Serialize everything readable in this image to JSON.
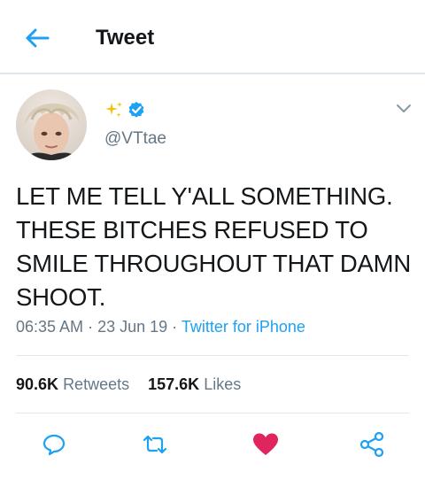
{
  "header": {
    "title": "Tweet"
  },
  "user": {
    "name_emoji": "sparkles",
    "verified": true,
    "handle": "@VTtae"
  },
  "tweet": {
    "lines": [
      "LET ME TELL Y'ALL SOMETHING.",
      "THESE BITCHES REFUSED TO",
      "SMILE THROUGHOUT THAT DAMN",
      "SHOOT."
    ],
    "time": "06:35 AM",
    "date": "23 Jun 19",
    "source": "Twitter for iPhone"
  },
  "stats": {
    "retweets_count": "90.6K",
    "retweets_label": "Retweets",
    "likes_count": "157.6K",
    "likes_label": "Likes"
  },
  "colors": {
    "accent": "#1da1f2",
    "like": "#e0245e",
    "muted": "#657786",
    "sparkle": "#f4c20d",
    "verified": "#1da1f2"
  },
  "icons": {
    "back": "arrow-left-icon",
    "more": "chevron-down-icon",
    "reply": "reply-icon",
    "retweet": "retweet-icon",
    "like": "heart-icon",
    "share": "share-icon"
  }
}
